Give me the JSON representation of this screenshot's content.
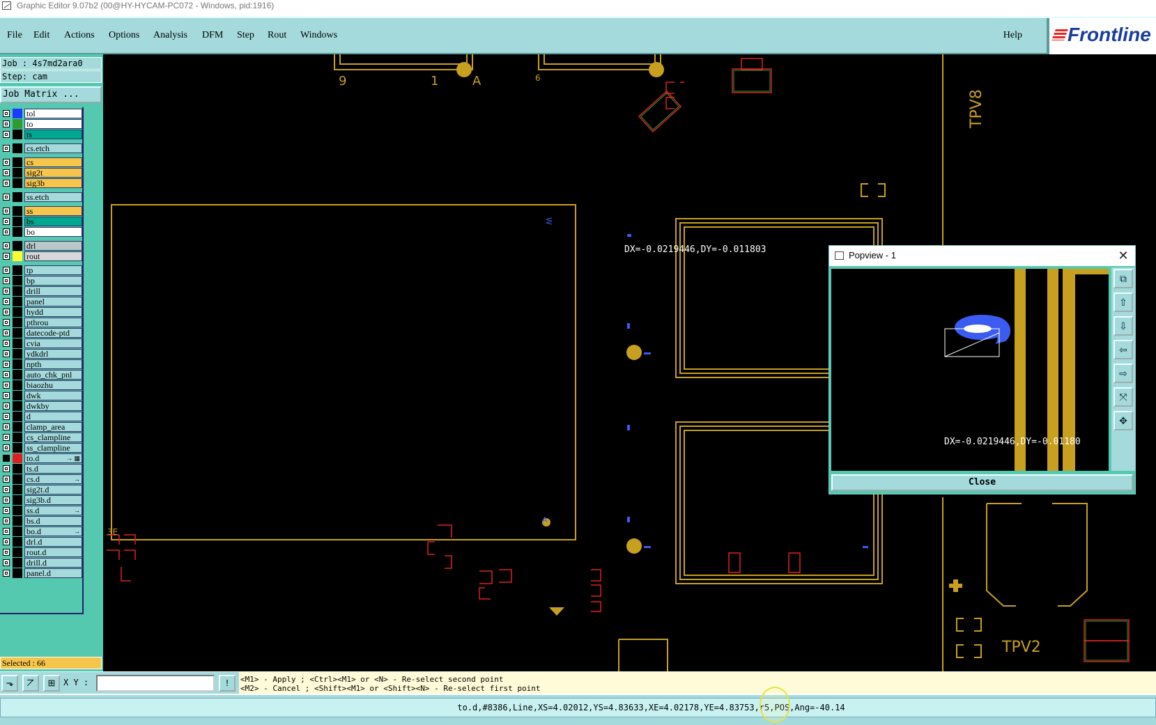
{
  "window": {
    "title": "Graphic Editor 9.07b2 (00@HY-HYCAM-PC072 - Windows, pid:1916)"
  },
  "menu": {
    "items": [
      "File",
      "Edit",
      "Actions",
      "Options",
      "Analysis",
      "DFM",
      "Step",
      "Rout",
      "Windows"
    ],
    "help": "Help",
    "logo": "Frontline"
  },
  "job": {
    "label": "Job : 4s7md2ara0",
    "step": "Step: cam",
    "matrix_button": "Job Matrix ..."
  },
  "layers": [
    {
      "name": "tol",
      "color": "#1b3cff",
      "bg": "#ffffff"
    },
    {
      "name": "to",
      "color": "#2e9a30",
      "bg": "#ffffff"
    },
    {
      "name": "ts",
      "color": "#000000",
      "bg": "#00a890"
    },
    {
      "name": "cs.etch",
      "color": "#000000",
      "bg": "#a4dadb"
    },
    {
      "name": "cs",
      "color": "#000000",
      "bg": "#f6c64c"
    },
    {
      "name": "sig2t",
      "color": "#000000",
      "bg": "#f6c64c"
    },
    {
      "name": "sig3b",
      "color": "#000000",
      "bg": "#f6c64c"
    },
    {
      "name": "ss.etch",
      "color": "#000000",
      "bg": "#a4dadb"
    },
    {
      "name": "ss",
      "color": "#000000",
      "bg": "#f6c64c"
    },
    {
      "name": "bs",
      "color": "#000000",
      "bg": "#00a890"
    },
    {
      "name": "bo",
      "color": "#000000",
      "bg": "#ffffff"
    },
    {
      "name": "drl",
      "color": "#000000",
      "bg": "#b8c8c8"
    },
    {
      "name": "rout",
      "color": "#ffff30",
      "bg": "#d8d8d8"
    },
    {
      "name": "tp",
      "color": "#000000",
      "bg": "#a4dadb"
    },
    {
      "name": "bp",
      "color": "#000000",
      "bg": "#a4dadb"
    },
    {
      "name": "drill",
      "color": "#000000",
      "bg": "#a4dadb"
    },
    {
      "name": "panel",
      "color": "#000000",
      "bg": "#a4dadb"
    },
    {
      "name": "hydd",
      "color": "#000000",
      "bg": "#a4dadb"
    },
    {
      "name": "pthrou",
      "color": "#000000",
      "bg": "#a4dadb"
    },
    {
      "name": "datecode-ptd",
      "color": "#000000",
      "bg": "#a4dadb"
    },
    {
      "name": "cvia",
      "color": "#000000",
      "bg": "#a4dadb"
    },
    {
      "name": "ydkdrl",
      "color": "#000000",
      "bg": "#a4dadb"
    },
    {
      "name": "npth",
      "color": "#000000",
      "bg": "#a4dadb"
    },
    {
      "name": "auto_chk_pnl",
      "color": "#000000",
      "bg": "#a4dadb"
    },
    {
      "name": "biaozhu",
      "color": "#000000",
      "bg": "#a4dadb"
    },
    {
      "name": "dwk",
      "color": "#000000",
      "bg": "#a4dadb"
    },
    {
      "name": "dwkby",
      "color": "#000000",
      "bg": "#a4dadb"
    },
    {
      "name": "d",
      "color": "#000000",
      "bg": "#a4dadb"
    },
    {
      "name": "clamp_area",
      "color": "#000000",
      "bg": "#a4dadb"
    },
    {
      "name": "cs_clampline",
      "color": "#000000",
      "bg": "#a4dadb"
    },
    {
      "name": "ss_clampline",
      "color": "#000000",
      "bg": "#a4dadb"
    },
    {
      "name": "to.d",
      "color": "#e02020",
      "bg": "#a4dadb",
      "mark": "→ ▦",
      "active": true
    },
    {
      "name": "ts.d",
      "color": "#000000",
      "bg": "#a4dadb"
    },
    {
      "name": "cs.d",
      "color": "#000000",
      "bg": "#a4dadb",
      "mark": "→"
    },
    {
      "name": "sig2t.d",
      "color": "#000000",
      "bg": "#a4dadb"
    },
    {
      "name": "sig3b.d",
      "color": "#000000",
      "bg": "#a4dadb"
    },
    {
      "name": "ss.d",
      "color": "#000000",
      "bg": "#a4dadb",
      "mark": "→"
    },
    {
      "name": "bs.d",
      "color": "#000000",
      "bg": "#a4dadb"
    },
    {
      "name": "bo.d",
      "color": "#000000",
      "bg": "#a4dadb",
      "mark": "→"
    },
    {
      "name": "drl.d",
      "color": "#000000",
      "bg": "#a4dadb"
    },
    {
      "name": "rout.d",
      "color": "#000000",
      "bg": "#a4dadb"
    },
    {
      "name": "drill.d",
      "color": "#000000",
      "bg": "#a4dadb"
    },
    {
      "name": "panel.d",
      "color": "#000000",
      "bg": "#a4dadb"
    }
  ],
  "selected": "Selected : 66",
  "canvas": {
    "measure": "DX=-0.0219446,DY=-0.011803",
    "labels": [
      "9",
      "1",
      "A",
      "6",
      "TPV8",
      "TPV2",
      "3E",
      "W",
      "A"
    ]
  },
  "popview": {
    "title": "Popview - 1",
    "measure": "DX=-0.0219446,DY=-0.01180",
    "close_label": "Close"
  },
  "bottom": {
    "xy_label": "X Y :",
    "xy_value": "",
    "msg_line1": "<M1> - Apply  ; <Ctrl><M1> or <N> - Re-select second point",
    "msg_line2": "<M2> - Cancel ; <Shift><M1> or <Shift><N> - Re-select first point"
  },
  "status": "to.d,#8386,Line,XS=4.02012,YS=4.83633,XE=4.02178,YE=4.83753,r5,POS,Ang=-40.14",
  "colors": {
    "gold": "#c8a020",
    "teal": "#55c8b0",
    "menu": "#a4dadb",
    "blue": "#3a5cf0",
    "red": "#e02020",
    "green": "#30a030"
  }
}
